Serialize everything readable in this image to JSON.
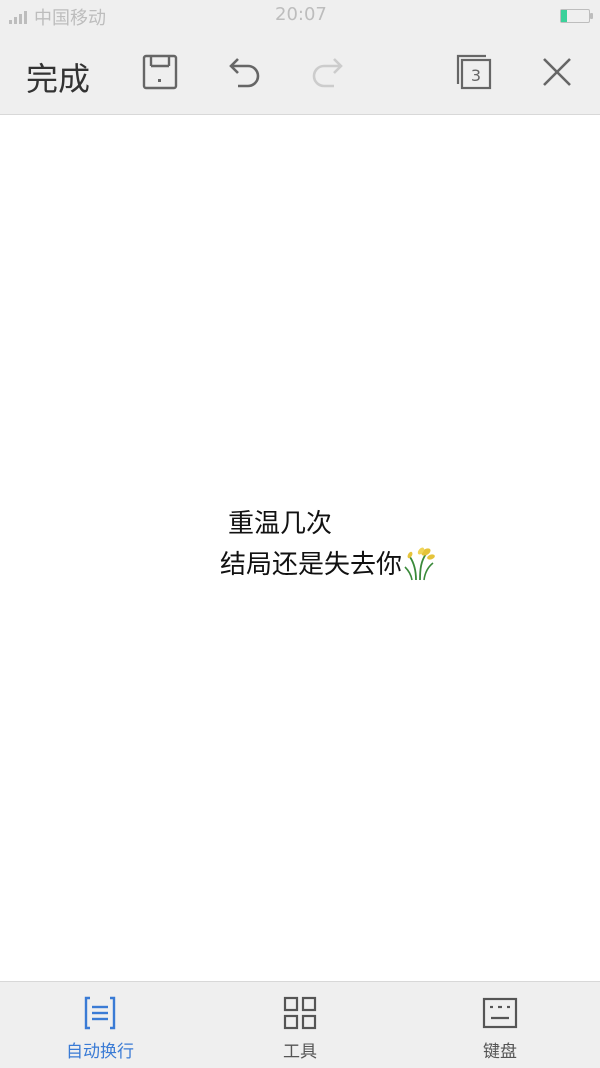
{
  "status_bar": {
    "carrier": "中国移动",
    "time": "20:07"
  },
  "toolbar": {
    "done_label": "完成",
    "pages_count": "3",
    "icons": [
      "save-icon",
      "undo-icon",
      "redo-icon",
      "pages-icon",
      "close-icon"
    ]
  },
  "document": {
    "line1": "重温几次",
    "line2": "结局还是失去你"
  },
  "bottom_bar": {
    "items": [
      {
        "label": "自动换行",
        "icon": "auto-wrap-icon",
        "active": true
      },
      {
        "label": "工具",
        "icon": "grid-icon",
        "active": false
      },
      {
        "label": "键盘",
        "icon": "keyboard-icon",
        "active": false
      }
    ]
  },
  "colors": {
    "accent": "#3a7bd5",
    "battery": "#3bd19a",
    "bar_bg": "#efefef"
  }
}
